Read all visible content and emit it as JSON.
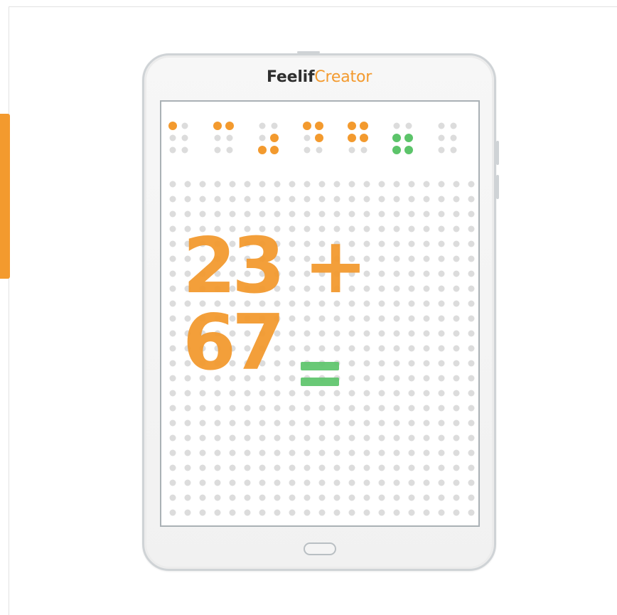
{
  "brand": {
    "part1": "Feelif",
    "part2": "Creator"
  },
  "braille": {
    "cells": [
      {
        "color": "orange",
        "dots": [
          1
        ]
      },
      {
        "color": "orange",
        "dots": [
          1,
          4
        ]
      },
      {
        "color": "orange",
        "dots": [
          3,
          5,
          6
        ]
      },
      {
        "color": "orange",
        "dots": [
          1,
          4,
          5
        ]
      },
      {
        "color": "orange",
        "dots": [
          1,
          2,
          4,
          5
        ]
      },
      {
        "color": "green",
        "dots": [
          2,
          3,
          5,
          6
        ]
      },
      {
        "color": "none",
        "dots": []
      }
    ]
  },
  "expression": {
    "text": "23 + 67"
  },
  "equals_label": "=",
  "colors": {
    "accent": "#f39a2e",
    "green": "#5cc46a",
    "dot": "#dcdcdc"
  }
}
